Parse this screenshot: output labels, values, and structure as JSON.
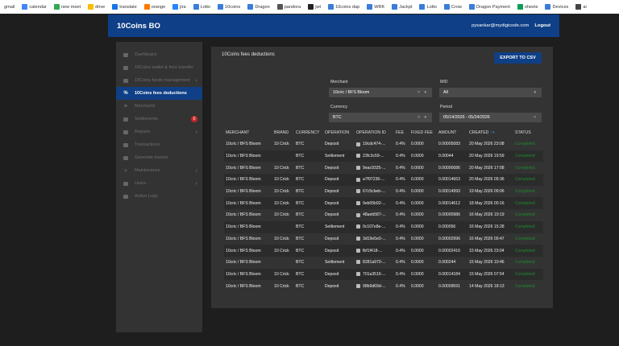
{
  "bookmarks": [
    {
      "label": "gmail",
      "color": "#ffffff"
    },
    {
      "label": "calendar",
      "color": "#4285f4"
    },
    {
      "label": "new meet",
      "color": "#34a853"
    },
    {
      "label": "drive",
      "color": "#fbbc04"
    },
    {
      "label": "translate",
      "color": "#1a73e8"
    },
    {
      "label": "orange",
      "color": "#ff7900"
    },
    {
      "label": "jira",
      "color": "#2684ff"
    },
    {
      "label": "Lotto",
      "color": "#3b7dd8"
    },
    {
      "label": "10coins",
      "color": "#3b7dd8"
    },
    {
      "label": "Dragon",
      "color": "#3b7dd8"
    },
    {
      "label": "pandora",
      "color": "#555555"
    },
    {
      "label": "jwt",
      "color": "#222222"
    },
    {
      "label": "10coins dap",
      "color": "#3b7dd8"
    },
    {
      "label": "WRK",
      "color": "#3b7dd8"
    },
    {
      "label": "Jackpt",
      "color": "#3b7dd8"
    },
    {
      "label": "Lotto",
      "color": "#3b7dd8"
    },
    {
      "label": "Crow",
      "color": "#3b7dd8"
    },
    {
      "label": "Dragon Payment",
      "color": "#3b7dd8"
    },
    {
      "label": "sheets",
      "color": "#0f9d58"
    },
    {
      "label": "Devices",
      "color": "#3b7dd8"
    },
    {
      "label": "ai",
      "color": "#444444"
    }
  ],
  "header": {
    "title": "10Coins BO",
    "user_email": "pysankar@mydigicode.com",
    "logout_label": "Logout"
  },
  "sidebar": {
    "items": [
      {
        "label": "Dashboard",
        "icon": "dashboard-icon",
        "glyph": "",
        "chevron": "",
        "badge": ""
      },
      {
        "label": "10Coins wallet & fees transfer",
        "icon": "wallet-icon",
        "glyph": "",
        "chevron": "",
        "badge": ""
      },
      {
        "label": "10Coins funds management",
        "icon": "funds-icon",
        "glyph": "",
        "chevron": "‹",
        "badge": ""
      },
      {
        "label": "10Coins fees deductions",
        "icon": "percent-icon",
        "glyph": "%",
        "chevron": "",
        "badge": "",
        "active": true
      },
      {
        "label": "Merchants",
        "icon": "merchants-icon",
        "glyph": "⚑",
        "chevron": "",
        "badge": ""
      },
      {
        "label": "Settlements",
        "icon": "settlements-icon",
        "glyph": "",
        "chevron": "",
        "badge": "0"
      },
      {
        "label": "Reports",
        "icon": "reports-icon",
        "glyph": "",
        "chevron": "‹",
        "badge": ""
      },
      {
        "label": "Transactions",
        "icon": "transactions-icon",
        "glyph": "",
        "chevron": "",
        "badge": ""
      },
      {
        "label": "Generate invoice",
        "icon": "invoice-icon",
        "glyph": "",
        "chevron": "",
        "badge": ""
      },
      {
        "label": "Maintenance",
        "icon": "wrench-icon",
        "glyph": "✕",
        "chevron": "‹",
        "badge": ""
      },
      {
        "label": "Users",
        "icon": "users-icon",
        "glyph": "",
        "chevron": "‹",
        "badge": ""
      },
      {
        "label": "Action Logs",
        "icon": "logs-icon",
        "glyph": "",
        "chevron": "",
        "badge": ""
      }
    ]
  },
  "panel": {
    "title": "10Coins fees deductions",
    "export_label": "EXPORT TO CSV"
  },
  "filters": {
    "merchant_label": "Merchant",
    "merchant_value": "10cric / BFS Bloom",
    "mid_label": "MID",
    "mid_value": "All",
    "currency_label": "Currency",
    "currency_value": "BTC",
    "period_label": "Period",
    "period_value": "05/14/2026 - 05/24/2026"
  },
  "table": {
    "columns": [
      "MERCHANT",
      "BRAND",
      "CURRENCY",
      "OPERATION",
      "OPERATION ID",
      "FEE",
      "FIXED FEE",
      "AMOUNT",
      "CREATED",
      "STATUS"
    ],
    "rows": [
      [
        "10cric / BFS Bloom",
        "10 Crick",
        "BTC",
        "Deposit",
        "19cdc474-...",
        "0.4%",
        "0.0000",
        "0.00005083",
        "20 May 2026 23:08",
        "Completed"
      ],
      [
        "10cric / BFS Bloom",
        "",
        "BTC",
        "Settlement",
        "23fc3c59-...",
        "0.4%",
        "0.0000",
        "0.00044",
        "20 May 2026 19:59",
        "Completed"
      ],
      [
        "10cric / BFS Bloom",
        "10 Crick",
        "BTC",
        "Deposit",
        "9eac9325-...",
        "0.4%",
        "0.0000",
        "0.00000086",
        "20 May 2026 17:08",
        "Completed"
      ],
      [
        "10cric / BFS Bloom",
        "10 Crick",
        "BTC",
        "Deposit",
        "a7f97236-...",
        "0.4%",
        "0.0000",
        "0.00014663",
        "20 May 2026 09:36",
        "Completed"
      ],
      [
        "10cric / BFS Bloom",
        "10 Crick",
        "BTC",
        "Deposit",
        "67c5cbeb-...",
        "0.4%",
        "0.0000",
        "0.00014993",
        "19 May 2026 09:06",
        "Completed"
      ],
      [
        "10cric / BFS Bloom",
        "10 Crick",
        "BTC",
        "Deposit",
        "9eb05b92-...",
        "0.4%",
        "0.0000",
        "0.00014612",
        "18 May 2026 00:16",
        "Completed"
      ],
      [
        "10cric / BFS Bloom",
        "10 Crick",
        "BTC",
        "Deposit",
        "48aeb587-...",
        "0.4%",
        "0.0000",
        "0.00000986",
        "16 May 2026 19:19",
        "Completed"
      ],
      [
        "10cric / BFS Bloom",
        "",
        "BTC",
        "Settlement",
        "0c107e8e-...",
        "0.4%",
        "0.0000",
        "0.000056",
        "16 May 2026 15:28",
        "Completed"
      ],
      [
        "10cric / BFS Bloom",
        "10 Crick",
        "BTC",
        "Deposit",
        "3d19e5e0-...",
        "0.4%",
        "0.0000",
        "0.00002996",
        "16 May 2026 09:47",
        "Completed"
      ],
      [
        "10cric / BFS Bloom",
        "10 Crick",
        "BTC",
        "Deposit",
        "fbf1f418-...",
        "0.4%",
        "0.0000",
        "0.00002416",
        "15 May 2026 23:04",
        "Completed"
      ],
      [
        "10cric / BFS Bloom",
        "",
        "BTC",
        "Settlement",
        "8281a970-...",
        "0.4%",
        "0.0000",
        "0.000244",
        "15 May 2026 10:46",
        "Completed"
      ],
      [
        "10cric / BFS Bloom",
        "10 Crick",
        "BTC",
        "Deposit",
        "701a3516-...",
        "0.4%",
        "0.0000",
        "0.00014184",
        "15 May 2026 07:54",
        "Completed"
      ],
      [
        "10cric / BFS Bloom",
        "10 Crick",
        "BTC",
        "Deposit",
        "98b9d69d-...",
        "0.4%",
        "0.0000",
        "0.00009591",
        "14 May 2026 18:13",
        "Completed"
      ]
    ]
  }
}
